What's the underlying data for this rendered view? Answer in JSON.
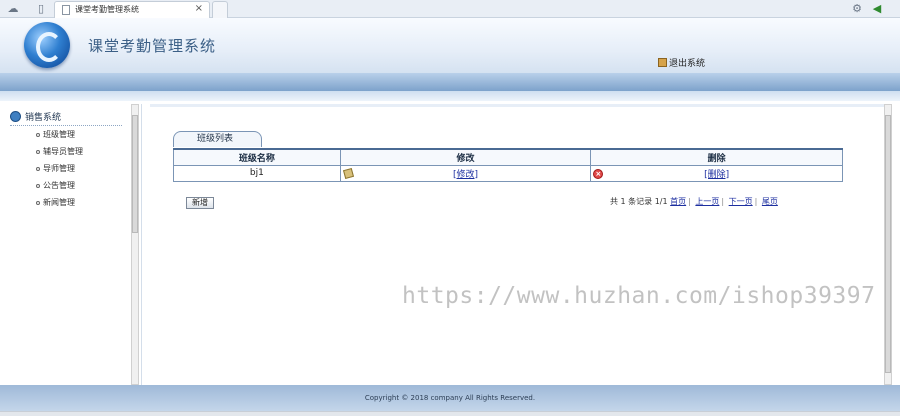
{
  "browser": {
    "tab_title": "课堂考勤管理系统",
    "tab_close": "×"
  },
  "header": {
    "app_title": "课堂考勤管理系统",
    "logout_label": "退出系统"
  },
  "sidebar": {
    "heading": "销售系统",
    "items": [
      {
        "label": "班级管理"
      },
      {
        "label": "辅导员管理"
      },
      {
        "label": "导师管理"
      },
      {
        "label": "公告管理"
      },
      {
        "label": "新闻管理"
      }
    ]
  },
  "main": {
    "list_tab": "班级列表",
    "columns": [
      "班级名称",
      "修改",
      "删除"
    ],
    "rows": [
      {
        "name": "bj1",
        "edit": "[修改]",
        "delete": "[删除]"
      }
    ],
    "add_button": "新增",
    "pager": {
      "summary": "共 1 条记录 1/1",
      "first": "首页",
      "prev": "上一页",
      "next": "下一页",
      "last": "尾页"
    }
  },
  "watermark": "https://www.huzhan.com/ishop39397",
  "footer": {
    "copyright": "Copyright © 2018 company All Rights Reserved."
  },
  "colors": {
    "band": "#7da2cb",
    "border": "#7b95b5",
    "link": "#1d2fa0"
  }
}
